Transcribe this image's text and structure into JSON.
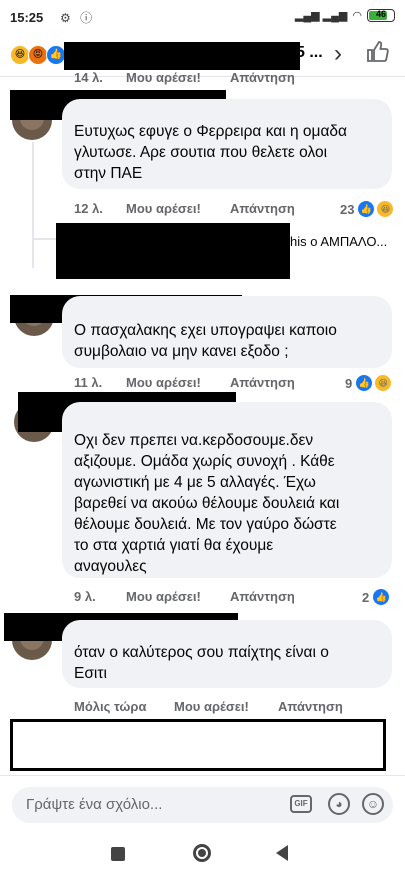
{
  "status": {
    "time": "15:25",
    "battery": "46"
  },
  "header": {
    "title": "5 ..."
  },
  "top_meta": {
    "time": "14 λ.",
    "like": "Μου αρέσει!",
    "reply": "Απάντηση"
  },
  "comments": [
    {
      "text": "Ευτυχως εφυγε ο Φερρειρα και η ομαδα\nγλυτωσε. Αρε σουτια που θελετε ολοι\nστην ΠΑΕ",
      "time": "12 λ.",
      "like": "Μου αρέσει!",
      "reply": "Απάντηση",
      "count": "23"
    },
    {
      "text": "Ο πασχαλακης εχει υπογραψει καποιο\nσυμβολαιο να μην κανει εξοδο  ;",
      "time": "11 λ.",
      "like": "Μου αρέσει!",
      "reply": "Απάντηση",
      "count": "9"
    },
    {
      "text": "Οχι δεν πρεπει να.κερδοσουμε.δεν\nαξιζουμε. Ομάδα χωρίς συνοχή .  Κάθε\nαγωνιστική με 4 με 5 αλλαγές. Έχω\nβαρεθεί να ακούω θέλουμε δουλειά και\nθέλουμε δουλειά. Με τον γαύρο δώστε\nτο στα χαρτιά γιατί θα έχουμε\nαναγουλες",
      "time": "9 λ.",
      "like": "Μου αρέσει!",
      "reply": "Απάντηση",
      "count": "2"
    },
    {
      "text": "όταν ο καλύτερος σου παίχτης είναι ο\nΕσιτι",
      "time": "Μόλις τώρα",
      "like": "Μου αρέσει!",
      "reply": "Απάντηση"
    }
  ],
  "reply_preview": {
    "text": "his ο ΑΜΠΑΛΟ..."
  },
  "input": {
    "placeholder": "Γράψτε ένα σχόλιο..."
  },
  "icons": {
    "gif": "GIF",
    "sticker": "sticker-icon",
    "emoji": "smile-icon",
    "like": "thumbs-up-icon",
    "haha": "haha-icon",
    "angry": "angry-icon"
  }
}
